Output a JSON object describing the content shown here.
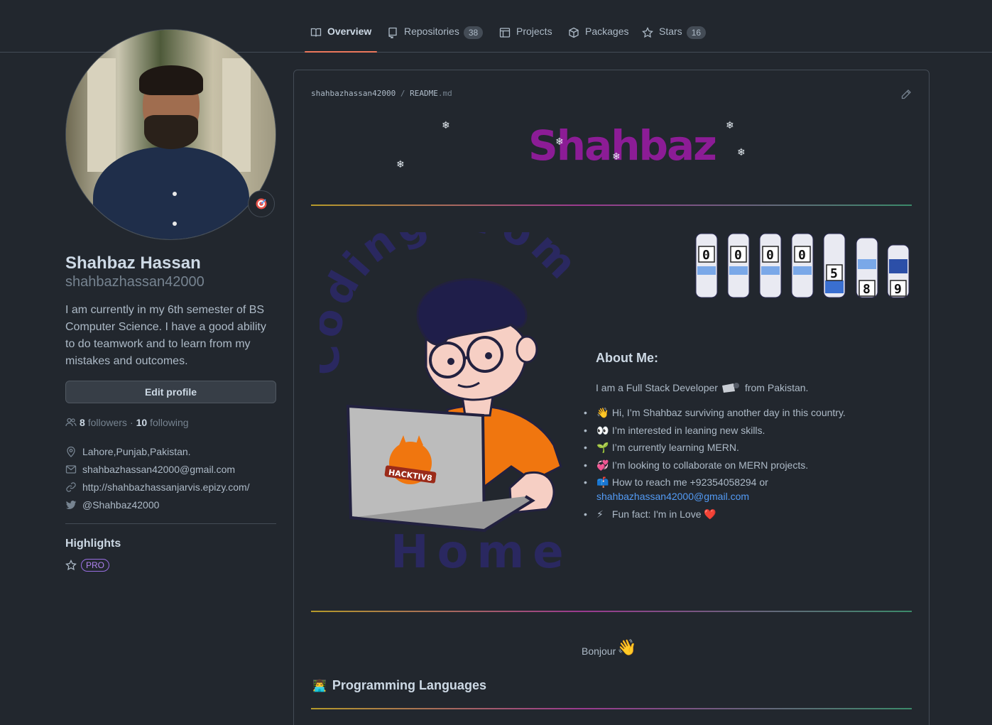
{
  "tabs": [
    {
      "label": "Overview",
      "icon": "book-icon",
      "active": true
    },
    {
      "label": "Repositories",
      "icon": "repo-icon",
      "count": "38"
    },
    {
      "label": "Projects",
      "icon": "table-icon"
    },
    {
      "label": "Packages",
      "icon": "package-icon"
    },
    {
      "label": "Stars",
      "icon": "star-icon",
      "count": "16"
    }
  ],
  "profile": {
    "name": "Shahbaz Hassan",
    "login": "shahbazhassan42000",
    "bio": "I am currently in my 6th semester of BS Computer Science. I have a good ability to do teamwork and to learn from my mistakes and outcomes.",
    "edit_label": "Edit profile",
    "followers_count": "8",
    "followers_label": "followers",
    "separator": "·",
    "following_count": "10",
    "following_label": "following",
    "location": "Lahore,Punjab,Pakistan.",
    "email": "shahbazhassan42000@gmail.com",
    "website": "http://shahbazhassanjarvis.epizy.com/",
    "twitter": "@Shahbaz42000"
  },
  "highlights": {
    "title": "Highlights",
    "badge": "PRO"
  },
  "readme": {
    "owner": "shahbazhassan42000",
    "slash": "/",
    "file": "README",
    "ext": ".md",
    "banner": "Shahbaz",
    "art_text_top": "Coding from",
    "art_text_bottom": "Home",
    "laptop_sticker": "HACKTIV8",
    "counter_digits": [
      "0",
      "0",
      "0",
      "0",
      "5",
      "8",
      "9"
    ],
    "about_title": "About Me:",
    "about_intro_1": "I am a Full Stack Developer",
    "about_intro_2": "from Pakistan.",
    "items": [
      {
        "emoji": "👋",
        "text": "Hi, I’m Shahbaz surviving another day in this country."
      },
      {
        "emoji": "👀",
        "text": "I’m interested in leaning new skills."
      },
      {
        "emoji": "🌱",
        "text": "I’m currently learning MERN."
      },
      {
        "emoji": "💞️",
        "text": "I’m looking to collaborate on MERN projects."
      },
      {
        "emoji": "📫",
        "text": "How to reach me +92354058294 or",
        "link": "shahbazhassan42000@gmail.com"
      },
      {
        "emoji": "⚡",
        "text": "Fun fact: I'm in Love",
        "suffix": "❤️"
      }
    ],
    "bonjour": "Bonjour",
    "bonjour_emoji": "👋",
    "programming_title": "Programming Languages",
    "programming_emoji": "👨‍💻"
  },
  "colors": {
    "accent_tab": "#ec775c",
    "banner": "#8c1c96",
    "link": "#539bf5",
    "pro": "#b083f0"
  }
}
